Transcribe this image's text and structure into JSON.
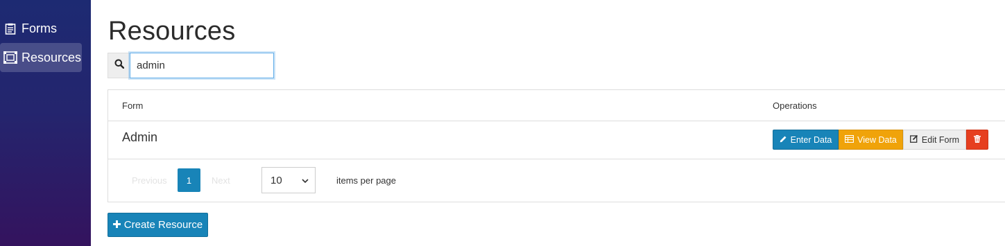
{
  "sidebar": {
    "items": [
      {
        "label": "Forms",
        "icon": "forms-icon"
      },
      {
        "label": "Resources",
        "icon": "resources-icon",
        "active": true
      }
    ]
  },
  "page": {
    "title": "Resources"
  },
  "search": {
    "value": "admin",
    "icon": "search-icon"
  },
  "table": {
    "headers": {
      "form": "Form",
      "operations": "Operations"
    },
    "rows": [
      {
        "form": "Admin",
        "actions": {
          "enter": "Enter Data",
          "view": "View Data",
          "edit": "Edit Form",
          "delete_icon": "trash-icon"
        }
      }
    ]
  },
  "pagination": {
    "previous": "Previous",
    "current_page": "1",
    "next": "Next",
    "per_page": "10",
    "per_page_label": "items per page"
  },
  "create_button": {
    "label": "Create Resource",
    "icon": "plus-icon"
  },
  "colors": {
    "primary": "#1884b8",
    "warning": "#f0a30a",
    "danger": "#e63f1f",
    "sidebar_top": "#1d2a72",
    "sidebar_bottom": "#34135e"
  }
}
